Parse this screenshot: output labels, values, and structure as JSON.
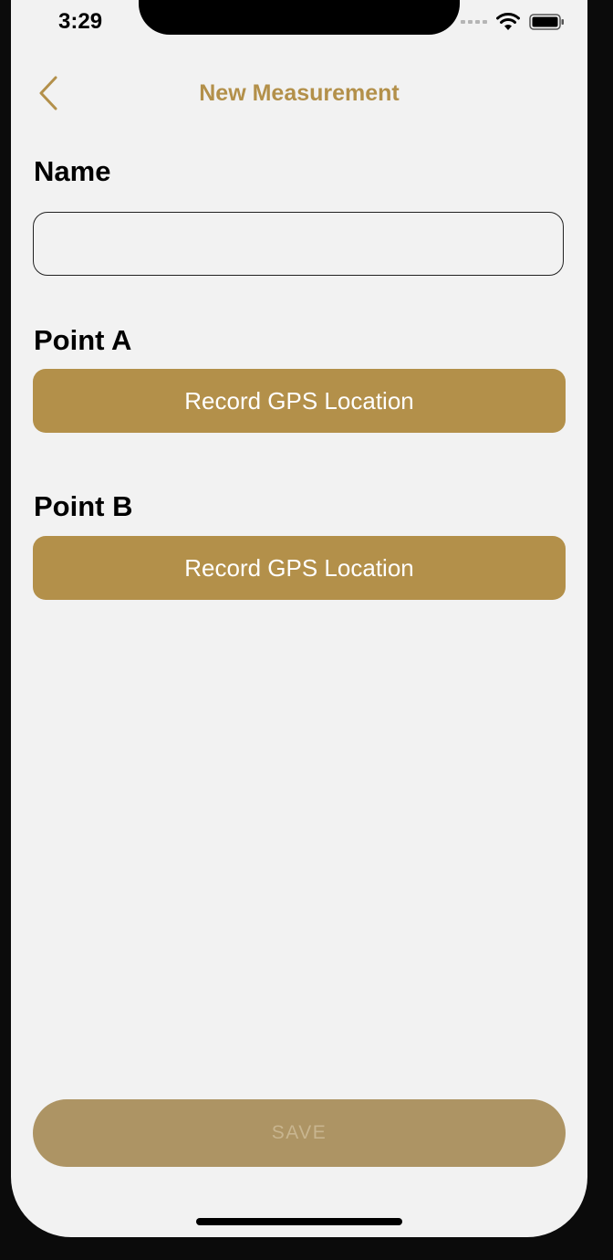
{
  "status_bar": {
    "time": "3:29",
    "icons": [
      "cellular-signal-icon",
      "wifi-icon",
      "battery-icon"
    ]
  },
  "nav": {
    "title": "New Measurement",
    "back_icon": "chevron-left-icon"
  },
  "form": {
    "name_label": "Name",
    "name_value": "",
    "point_a_label": "Point A",
    "point_a_button": "Record GPS Location",
    "point_b_label": "Point B",
    "point_b_button": "Record GPS Location",
    "save_label": "SAVE"
  },
  "colors": {
    "accent": "#b3904a",
    "save_button_disabled": "#ad9464",
    "background": "#f2f2f2"
  }
}
